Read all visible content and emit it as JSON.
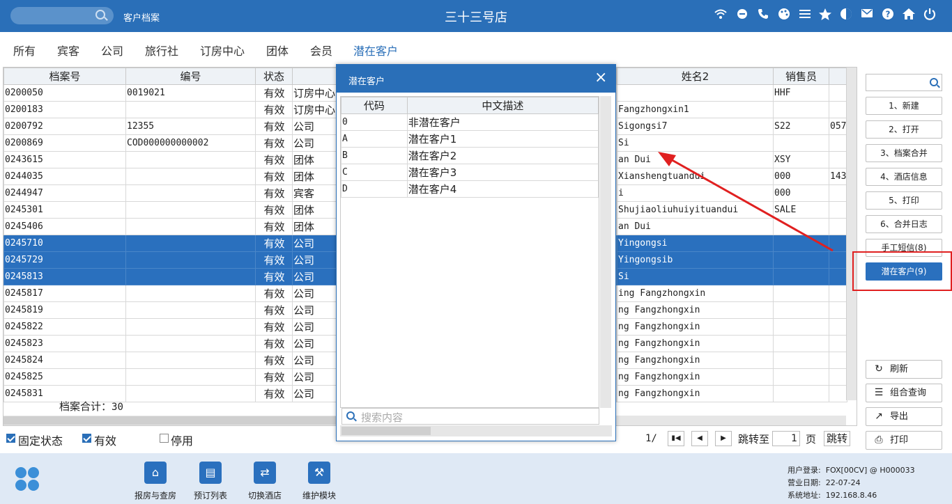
{
  "topbar": {
    "breadcrumb": "客户档案",
    "title": "三十三号店",
    "icons": [
      "wifi-icon",
      "chat-icon",
      "phone-icon",
      "palette-icon",
      "menu-icon",
      "star-icon",
      "theme-icon",
      "mail-icon",
      "help-icon",
      "home-icon",
      "power-icon"
    ]
  },
  "tabs": [
    "所有",
    "宾客",
    "公司",
    "旅行社",
    "订房中心",
    "团体",
    "会员",
    "潜在客户"
  ],
  "table": {
    "headers": [
      "档案号",
      "编号",
      "状态",
      "",
      "",
      "姓名2",
      "销售员",
      ""
    ],
    "rows": [
      {
        "id": "0200050",
        "code": "0019021",
        "status": "有效",
        "type": "订房中心",
        "name2": "",
        "sales": "HHF",
        "extra": "",
        "sel": false
      },
      {
        "id": "0200183",
        "code": "",
        "status": "有效",
        "type": "订房中心",
        "name2": " Fangzhongxin1",
        "sales": "",
        "extra": "",
        "sel": false
      },
      {
        "id": "0200792",
        "code": "12355",
        "status": "有效",
        "type": "公司",
        "name2": " Sigongsi7",
        "sales": "S22",
        "extra": "057",
        "sel": false
      },
      {
        "id": "0200869",
        "code": "COD000000000002",
        "status": "有效",
        "type": "公司",
        "name2": " Si",
        "sales": "",
        "extra": "",
        "sel": false
      },
      {
        "id": "0243615",
        "code": "",
        "status": "有效",
        "type": "团体",
        "name2": "an Dui",
        "sales": "XSY",
        "extra": "",
        "sel": false
      },
      {
        "id": "0244035",
        "code": "",
        "status": "有效",
        "type": "团体",
        "name2": " Xianshengtuandui",
        "sales": "000",
        "extra": "143",
        "sel": false
      },
      {
        "id": "0244947",
        "code": "",
        "status": "有效",
        "type": "宾客",
        "name2": "i",
        "sales": "000",
        "extra": "",
        "sel": false
      },
      {
        "id": "0245301",
        "code": "",
        "status": "有效",
        "type": "团体",
        "name2": "Shujiaoliuhuiyituandui",
        "sales": "SALE",
        "extra": "",
        "sel": false
      },
      {
        "id": "0245406",
        "code": "",
        "status": "有效",
        "type": "团体",
        "name2": "an Dui",
        "sales": "",
        "extra": "",
        "sel": false
      },
      {
        "id": "0245710",
        "code": "",
        "status": "有效",
        "type": "公司",
        "name2": "Yingongsi",
        "sales": "",
        "extra": "",
        "sel": true
      },
      {
        "id": "0245729",
        "code": "",
        "status": "有效",
        "type": "公司",
        "name2": "Yingongsib",
        "sales": "",
        "extra": "",
        "sel": true
      },
      {
        "id": "0245813",
        "code": "",
        "status": "有效",
        "type": "公司",
        "name2": " Si",
        "sales": "",
        "extra": "",
        "sel": true
      },
      {
        "id": "0245817",
        "code": "",
        "status": "有效",
        "type": "公司",
        "name2": "ing Fangzhongxin",
        "sales": "",
        "extra": "",
        "sel": false
      },
      {
        "id": "0245819",
        "code": "",
        "status": "有效",
        "type": "公司",
        "name2": "ng Fangzhongxin",
        "sales": "",
        "extra": "",
        "sel": false
      },
      {
        "id": "0245822",
        "code": "",
        "status": "有效",
        "type": "公司",
        "name2": "ng Fangzhongxin",
        "sales": "",
        "extra": "",
        "sel": false
      },
      {
        "id": "0245823",
        "code": "",
        "status": "有效",
        "type": "公司",
        "name2": "ng Fangzhongxin",
        "sales": "",
        "extra": "",
        "sel": false
      },
      {
        "id": "0245824",
        "code": "",
        "status": "有效",
        "type": "公司",
        "name2": "ng Fangzhongxin",
        "sales": "",
        "extra": "",
        "sel": false
      },
      {
        "id": "0245825",
        "code": "",
        "status": "有效",
        "type": "公司",
        "name2": "ng Fangzhongxin",
        "sales": "",
        "extra": "",
        "sel": false
      },
      {
        "id": "0245831",
        "code": "",
        "status": "有效",
        "type": "公司",
        "name2": "ng Fangzhongxin",
        "sales": "",
        "extra": "",
        "sel": false
      }
    ],
    "total_label": "档案合计：",
    "total_value": "30"
  },
  "filters": {
    "fixed_status": {
      "label": "固定状态",
      "checked": true
    },
    "valid": {
      "label": "有效",
      "checked": true
    },
    "disabled": {
      "label": "停用",
      "checked": false
    }
  },
  "pager": {
    "page_text": "1/",
    "goto_label": "跳转至",
    "page_value": "1",
    "page_unit": "页",
    "jump_label": "跳转"
  },
  "right_panel": {
    "buttons": [
      "1、新建",
      "2、打开",
      "3、档案合并",
      "4、酒店信息",
      "5、打印",
      "6、合并日志",
      "手工短信(8)",
      "潜在客户(9)"
    ],
    "actions": [
      {
        "label": "刷新",
        "icon": "refresh-icon"
      },
      {
        "label": "组合查询",
        "icon": "list-icon"
      },
      {
        "label": "导出",
        "icon": "export-icon"
      },
      {
        "label": "打印",
        "icon": "print-icon"
      }
    ]
  },
  "footer": {
    "buttons": [
      {
        "label": "报房与查房",
        "icon": "house-check-icon"
      },
      {
        "label": "预订列表",
        "icon": "booking-list-icon"
      },
      {
        "label": "切换酒店",
        "icon": "switch-icon"
      },
      {
        "label": "维护模块",
        "icon": "wrench-icon"
      }
    ],
    "user_label": "用户登录:",
    "user_value": "FOX[00CV] @ H000033",
    "date_label": "营业日期:",
    "date_value": "22-07-24",
    "addr_label": "系统地址:",
    "addr_value": "192.168.8.46"
  },
  "modal": {
    "title": "潜在客户",
    "headers": [
      "代码",
      "中文描述"
    ],
    "rows": [
      {
        "code": "0",
        "desc": "非潜在客户"
      },
      {
        "code": "A",
        "desc": "潜在客户1"
      },
      {
        "code": "B",
        "desc": "潜在客户2"
      },
      {
        "code": "C",
        "desc": "潜在客户3"
      },
      {
        "code": "D",
        "desc": "潜在客户4"
      }
    ],
    "search_placeholder": "搜索内容"
  },
  "colors": {
    "primary": "#2a6fb8",
    "selection": "#2a70be",
    "annotation": "#e02020",
    "footer_bg": "#dfe9f5"
  }
}
